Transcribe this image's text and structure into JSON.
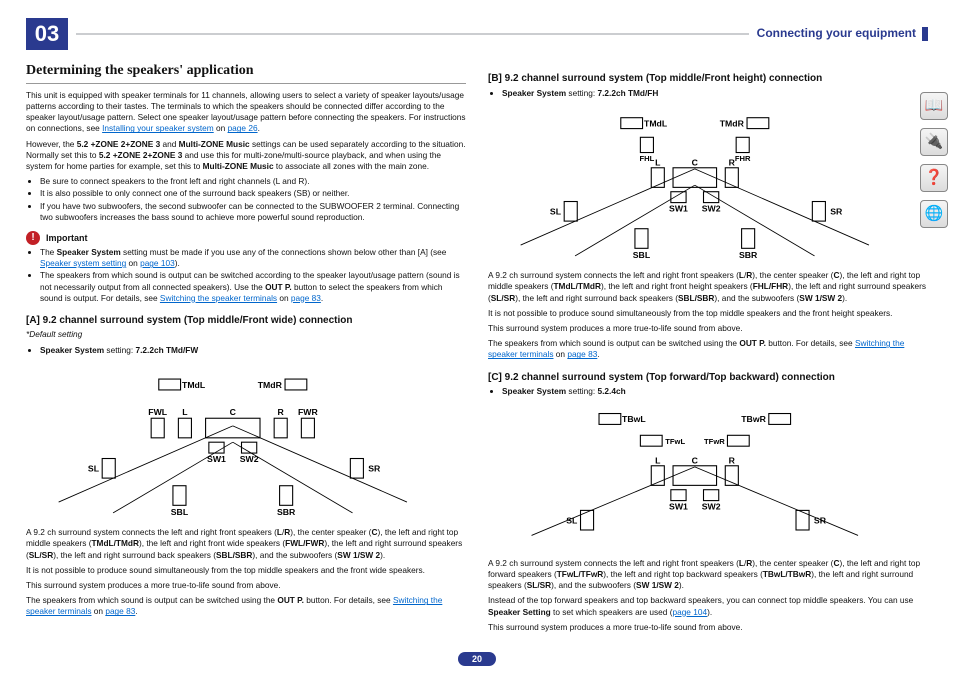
{
  "header": {
    "chapter": "03",
    "title": "Connecting your equipment"
  },
  "page_number": "20",
  "side_icons": [
    "book-icon",
    "device-icon",
    "help-icon",
    "network-icon"
  ],
  "left": {
    "h2": "Determining the speakers' application",
    "intro1": "This unit is equipped with speaker terminals for 11 channels, allowing users to select a variety of speaker layouts/usage patterns according to their tastes. The terminals to which the speakers should be connected differ according to the speaker layout/usage pattern. Select one speaker layout/usage pattern before connecting the speakers. For instructions on connections, see ",
    "intro1_link": "Installing your speaker system",
    "intro1_tail": " on ",
    "intro1_page_link": "page 26",
    "intro1_end": ".",
    "intro2a": "However, the ",
    "intro2b": "5.2 +ZONE 2+ZONE 3",
    "intro2c": " and ",
    "intro2d": "Multi-ZONE Music",
    "intro2e": " settings can be used separately according to the situation. Normally set this to ",
    "intro2f": "5.2 +ZONE 2+ZONE 3",
    "intro2g": " and use this for multi-zone/multi-source playback, and when using the system for home parties for example, set this to ",
    "intro2h": "Multi-ZONE Music",
    "intro2i": " to associate all zones with the main zone.",
    "bullets": [
      "Be sure to connect speakers to the front left and right channels (L and R).",
      "It is also possible to only connect one of the surround back speakers (SB) or neither.",
      "If you have two subwoofers, the second subwoofer can be connected to the SUBWOOFER 2 terminal. Connecting two subwoofers increases the bass sound to achieve more powerful sound reproduction."
    ],
    "important_label": "Important",
    "imp_items": {
      "a1": "The ",
      "a2": "Speaker System",
      "a3": " setting must be made if you use any of the connections shown below other than [A] (see ",
      "a_link": "Speaker system setting",
      "a4": " on ",
      "a_page": "page 103",
      "a5": ").",
      "b1": "The speakers from which sound is output can be switched according to the speaker layout/usage pattern (sound is not necessarily output from all connected speakers). Use the ",
      "b2": "OUT P.",
      "b3": " button to select the speakers from which sound is output. For details, see ",
      "b_link": "Switching the speaker terminals",
      "b4": " on ",
      "b_page": "page 83",
      "b5": "."
    },
    "sectA": {
      "h3": "[A] 9.2 channel surround system (Top middle/Front wide) connection",
      "note": "*Default setting",
      "setting_label": "Speaker System",
      "setting_prefix": " setting: ",
      "setting_value": "7.2.2ch TMd/FW",
      "para1a": "A 9.2 ch surround system connects the left and right front speakers (",
      "p_L": "L",
      "p_slash1": "/",
      "p_R": "R",
      "para1b": "), the center speaker (",
      "p_C": "C",
      "para1c": "), the left and right top middle speakers (",
      "p_TM": "TMdL/TMdR",
      "para1d": "), the left and right front wide speakers (",
      "p_FW": "FWL/FWR",
      "para1e": "), the left and right surround speakers (",
      "p_SL": "SL/SR",
      "para1f": "), the left and right surround back speakers (",
      "p_SB": "SBL/SBR",
      "para1g": "), and the subwoofers (",
      "p_SW": "SW 1/SW 2",
      "para1h": ").",
      "para2": "It is not possible to produce sound simultaneously from the top middle speakers and the front wide speakers.",
      "para3": "This surround system produces a more true-to-life sound from above.",
      "para4a": "The speakers from which sound is output can be switched using the ",
      "para4b": "OUT P.",
      "para4c": " button. For details, see ",
      "para4_link": "Switching the speaker terminals",
      "para4d": " on ",
      "para4_page": "page 83",
      "para4e": "."
    }
  },
  "right": {
    "sectB": {
      "h3": "[B] 9.2 channel surround system (Top middle/Front height) connection",
      "setting_label": "Speaker System",
      "setting_prefix": " setting: ",
      "setting_value": "7.2.2ch TMd/FH",
      "para1a": "A 9.2 ch surround system connects the left and right front speakers (",
      "p_L": "L",
      "p_slash": "/",
      "p_R": "R",
      "para1b": "), the center speaker (",
      "p_C": "C",
      "para1c": "), the left and right top middle speakers (",
      "p_TM": "TMdL/TMdR",
      "para1d": "), the left and right front height speakers (",
      "p_FH": "FHL/FHR",
      "para1e": "), the left and right surround speakers (",
      "p_SL": "SL/SR",
      "para1f": "), the left and right surround back speakers (",
      "p_SB": "SBL/SBR",
      "para1g": "), and the subwoofers (",
      "p_SW": "SW 1/SW 2",
      "para1h": ").",
      "para2": "It is not possible to produce sound simultaneously from the top middle speakers and the front height speakers.",
      "para3": "This surround system produces a more true-to-life sound from above.",
      "para4a": "The speakers from which sound is output can be switched using the ",
      "para4b": "OUT P.",
      "para4c": " button. For details, see ",
      "para4_link": "Switching the speaker terminals",
      "para4d": " on ",
      "para4_page": "page 83",
      "para4e": "."
    },
    "sectC": {
      "h3": "[C] 9.2 channel surround system (Top forward/Top backward) connection",
      "setting_label": "Speaker System",
      "setting_prefix": " setting: ",
      "setting_value": "5.2.4ch",
      "para1a": "A 9.2 ch surround system connects the left and right front speakers (",
      "p_L": "L",
      "p_slash": "/",
      "p_R": "R",
      "para1b": "), the center speaker (",
      "p_C": "C",
      "para1c": "), the left and right top forward speakers (",
      "p_TF": "TFwL/TFwR",
      "para1d": "), the left and right top backward speakers (",
      "p_TB": "TBwL/TBwR",
      "para1e": "), the left and right surround speakers (",
      "p_SL": "SL/SR",
      "para1f": "), and the subwoofers (",
      "p_SW": "SW 1/SW 2",
      "para1g": ").",
      "para2a": "Instead of the top forward speakers and top backward speakers, you can connect top middle speakers. You can use ",
      "para2b": "Speaker Setting",
      "para2c": " to set which speakers are used (",
      "para2_link": "page 104",
      "para2d": ").",
      "para3": "This surround system produces a more true-to-life sound from above."
    }
  },
  "chart_data": [
    {
      "type": "diagram",
      "id": "A",
      "title": "9.2ch Top middle / Front wide",
      "speakers": [
        "TMdL",
        "TMdR",
        "FWL",
        "L",
        "C",
        "R",
        "FWR",
        "SW1",
        "SW2",
        "SL",
        "SR",
        "SBL",
        "SBR"
      ]
    },
    {
      "type": "diagram",
      "id": "B",
      "title": "9.2ch Top middle / Front height",
      "speakers": [
        "TMdL",
        "TMdR",
        "FHL",
        "FHR",
        "L",
        "C",
        "R",
        "SW1",
        "SW2",
        "SL",
        "SR",
        "SBL",
        "SBR"
      ]
    },
    {
      "type": "diagram",
      "id": "C",
      "title": "9.2ch Top forward / Top backward",
      "speakers": [
        "TBwL",
        "TBwR",
        "TFwL",
        "TFwR",
        "L",
        "C",
        "R",
        "SW1",
        "SW2",
        "SL",
        "SR"
      ]
    }
  ]
}
